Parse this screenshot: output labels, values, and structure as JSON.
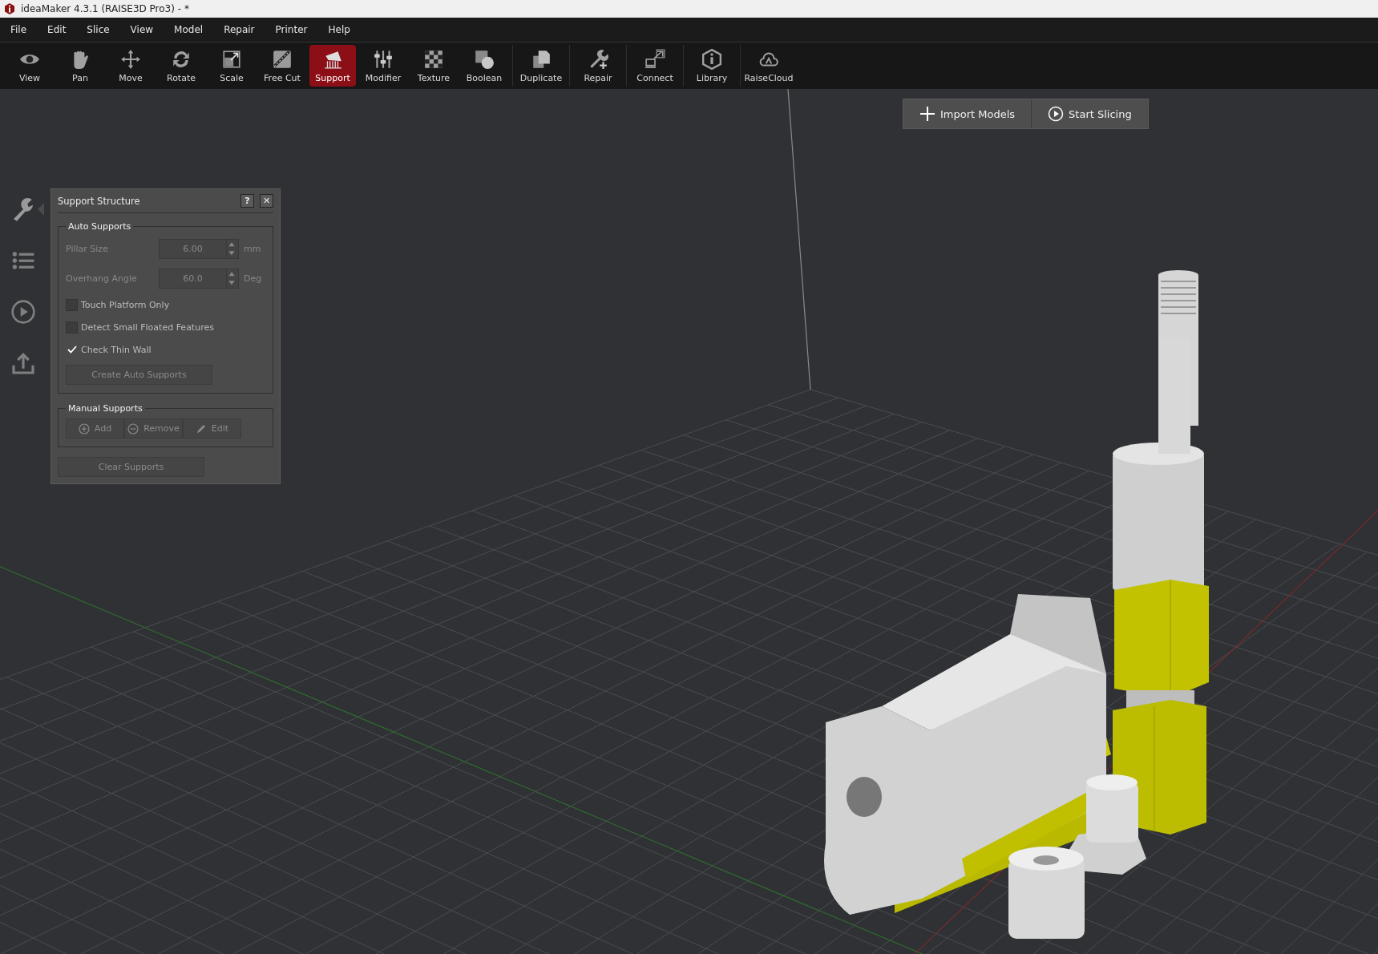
{
  "window": {
    "title": "ideaMaker 4.3.1 (RAISE3D Pro3) - *"
  },
  "menu": [
    "File",
    "Edit",
    "Slice",
    "View",
    "Model",
    "Repair",
    "Printer",
    "Help"
  ],
  "toolbar": {
    "groups": [
      [
        {
          "label": "View",
          "selected": false
        },
        {
          "label": "Pan",
          "selected": false
        },
        {
          "label": "Move",
          "selected": false
        },
        {
          "label": "Rotate",
          "selected": false
        },
        {
          "label": "Scale",
          "selected": false
        },
        {
          "label": "Free Cut",
          "selected": false
        },
        {
          "label": "Support",
          "selected": true
        },
        {
          "label": "Modifier",
          "selected": false
        },
        {
          "label": "Texture",
          "selected": false
        },
        {
          "label": "Boolean",
          "selected": false
        }
      ],
      [
        {
          "label": "Duplicate",
          "selected": false
        }
      ],
      [
        {
          "label": "Repair",
          "selected": false
        }
      ],
      [
        {
          "label": "Connect",
          "selected": false
        }
      ],
      [
        {
          "label": "Library",
          "selected": false
        }
      ],
      [
        {
          "label": "RaiseCloud",
          "selected": false
        }
      ]
    ]
  },
  "actions": [
    "Import Models",
    "Start Slicing"
  ],
  "side_tabs": [
    {
      "selected": true
    },
    {
      "selected": false
    },
    {
      "selected": false
    },
    {
      "selected": false
    }
  ],
  "support_panel": {
    "title": "Support Structure",
    "help": "?",
    "close": "✕",
    "auto": {
      "title": "Auto Supports",
      "fields": [
        {
          "label": "Pillar Size",
          "value": "6.00",
          "unit": "mm",
          "disabled": true
        },
        {
          "label": "Overhang Angle",
          "value": "60.0",
          "unit": "Deg",
          "disabled": true
        }
      ],
      "checks": [
        {
          "label": "Touch Platform Only",
          "checked": false
        },
        {
          "label": "Detect Small Floated Features",
          "checked": false
        },
        {
          "label": "Check Thin Wall",
          "checked": true
        }
      ],
      "button": "Create Auto Supports"
    },
    "manual": {
      "title": "Manual Supports",
      "buttons": [
        "Add",
        "Remove",
        "Edit"
      ]
    },
    "clear": "Clear Supports"
  }
}
